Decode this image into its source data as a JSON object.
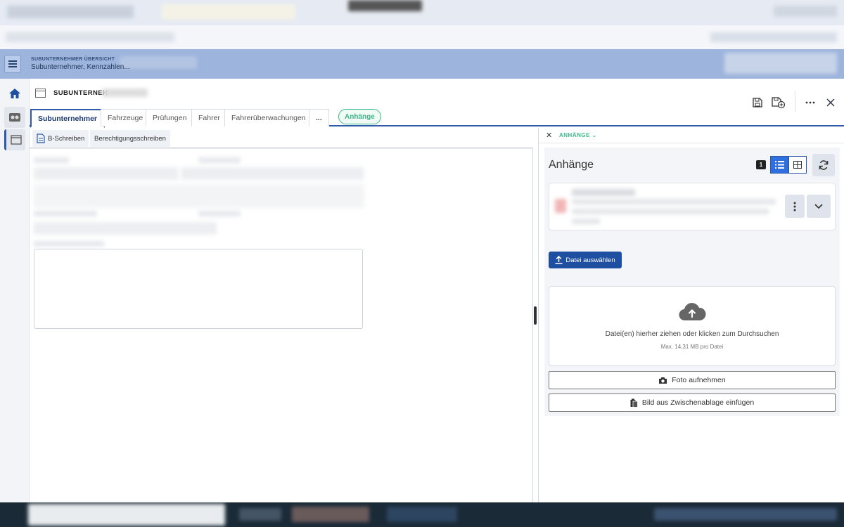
{
  "header": {
    "section_label": "SUBUNTERNEHMER ÜBERSICHT",
    "breadcrumb": "Subunternehmer, Kennzahlen..."
  },
  "record": {
    "title": "SUBUNTERNEH"
  },
  "tabs": [
    {
      "label": "Subunternehmer",
      "active": true
    },
    {
      "label": "Fahrzeuge",
      "active": false
    },
    {
      "label": "Prüfungen",
      "active": false
    },
    {
      "label": "Fahrer",
      "active": false
    },
    {
      "label": "Fahrerüberwachungen",
      "active": false
    },
    {
      "label": "...",
      "active": false
    }
  ],
  "attachments_pill": "Anhänge",
  "subtoolbar": {
    "b_schreiben": "B-Schreiben",
    "berechtigung": "Berechtigungsschreiben"
  },
  "attachments_panel": {
    "header_label": "ANHÄNGE",
    "title": "Anhänge",
    "count": "1",
    "upload_button": "Datei auswählen",
    "dropzone_text": "Datei(en) hierher ziehen oder klicken zum Durchsuchen",
    "dropzone_limit": "Max. 14,31 MB pro Datei",
    "photo_button": "Foto aufnehmen",
    "clipboard_button": "Bild aus Zwischenablage einfügen"
  },
  "colors": {
    "accent": "#2f5aa8",
    "success": "#3cb88a",
    "primary_button": "#1f4fa0",
    "header_bg": "#9db4dc"
  }
}
